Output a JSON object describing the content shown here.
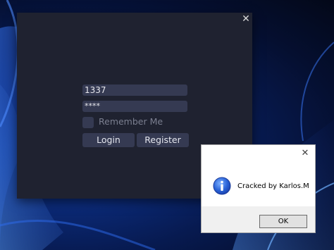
{
  "login_window": {
    "close_glyph": "✕",
    "username_value": "1337",
    "password_value": "****",
    "remember_label": "Remember Me",
    "login_label": "Login",
    "register_label": "Register"
  },
  "message_box": {
    "close_glyph": "✕",
    "icon": "info-icon",
    "message": "Cracked by Karlos.M",
    "ok_label": "OK"
  },
  "colors": {
    "window_bg": "#1f2230",
    "control_bg": "#353a52",
    "wallpaper_accent": "#1e5bd8"
  }
}
